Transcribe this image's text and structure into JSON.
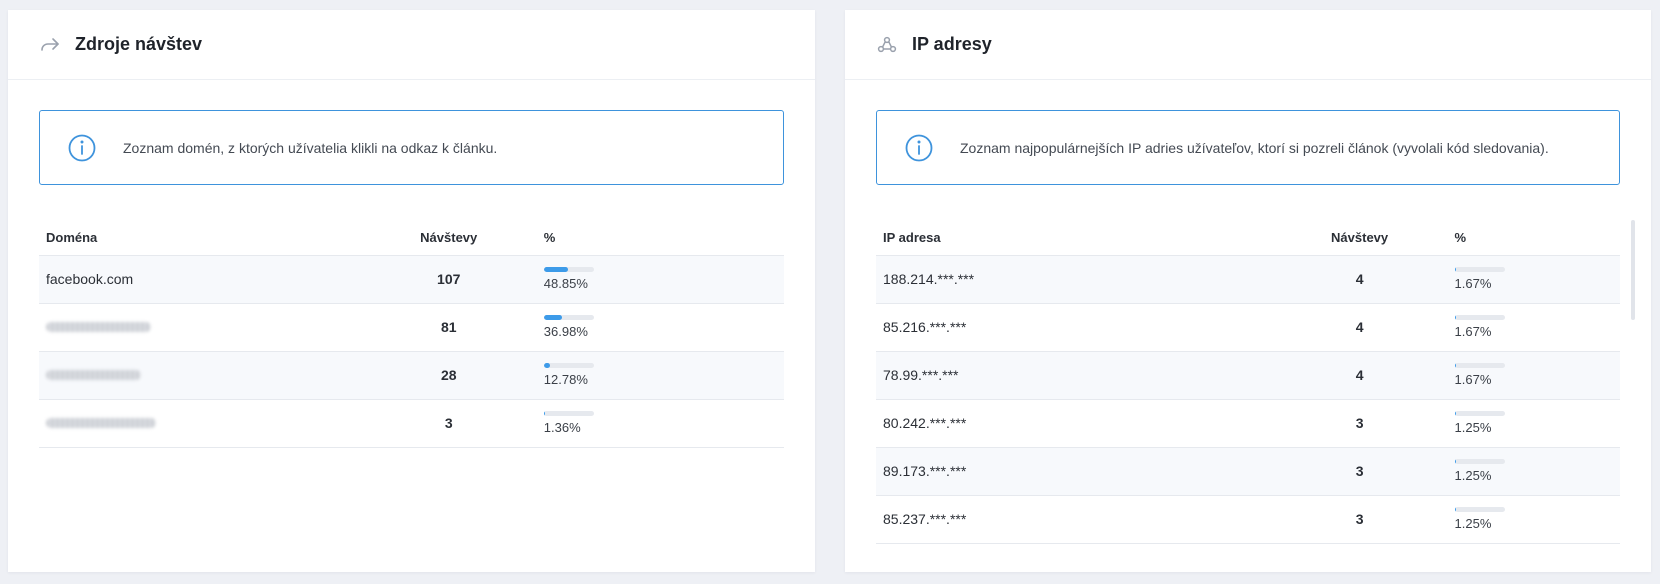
{
  "left_panel": {
    "title": "Zdroje návštev",
    "icon": "share-arrow-icon",
    "info": "Zoznam domén, z ktorých užívatelia klikli na odkaz k článku.",
    "columns": [
      "Doména",
      "Návštevy",
      "%"
    ],
    "rows": [
      {
        "domain": "facebook.com",
        "visits": "107",
        "percent": "48.85%",
        "fraction": 0.4885
      },
      {
        "domain": "",
        "visits": "81",
        "percent": "36.98%",
        "fraction": 0.3698
      },
      {
        "domain": "",
        "visits": "28",
        "percent": "12.78%",
        "fraction": 0.1278
      },
      {
        "domain": "",
        "visits": "3",
        "percent": "1.36%",
        "fraction": 0.0136
      }
    ]
  },
  "right_panel": {
    "title": "IP adresy",
    "icon": "network-nodes-icon",
    "info": "Zoznam najpopulárnejších IP adries užívateľov, ktorí si pozreli článok (vyvolali kód sledovania).",
    "columns": [
      "IP adresa",
      "Návštevy",
      "%"
    ],
    "rows": [
      {
        "ip": "188.214.***.***",
        "visits": "4",
        "percent": "1.67%",
        "fraction": 0.0167
      },
      {
        "ip": "85.216.***.***",
        "visits": "4",
        "percent": "1.67%",
        "fraction": 0.0167
      },
      {
        "ip": "78.99.***.***",
        "visits": "4",
        "percent": "1.67%",
        "fraction": 0.0167
      },
      {
        "ip": "80.242.***.***",
        "visits": "3",
        "percent": "1.25%",
        "fraction": 0.0125
      },
      {
        "ip": "89.173.***.***",
        "visits": "3",
        "percent": "1.25%",
        "fraction": 0.0125
      },
      {
        "ip": "85.237.***.***",
        "visits": "3",
        "percent": "1.25%",
        "fraction": 0.0125
      }
    ]
  },
  "colors": {
    "accent": "#3d9be9",
    "info_border": "#3e93dc",
    "icon_gray": "#9aa1ad"
  }
}
